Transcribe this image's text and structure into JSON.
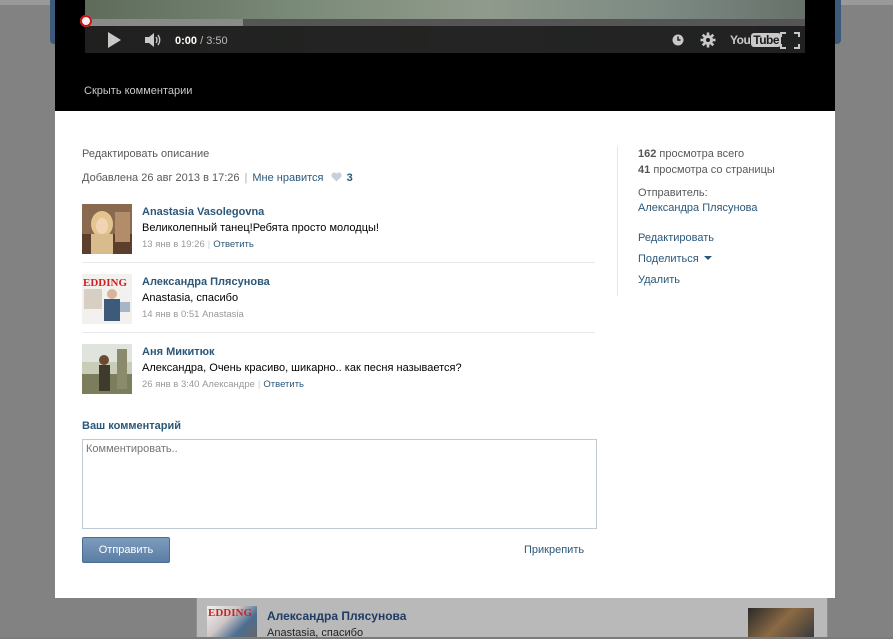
{
  "player": {
    "current_time": "0:00",
    "total_time": "3:50",
    "progress": 0.0,
    "buffered": 0.22,
    "brand": "You",
    "brand_tube": "Tube"
  },
  "hide_comments_label": "Скрыть комментарии",
  "description": {
    "edit_label": "Редактировать описание",
    "added_text": "Добавлена 26 авг 2013 в 17:26",
    "like_label": "Мне нравится",
    "like_count": "3"
  },
  "comments": [
    {
      "author": "Anastasia Vasolegovna",
      "text": "Великолепный танец!Ребята просто молодцы!",
      "date": "13 янв в 19:26",
      "reply": "Ответить",
      "extra": ""
    },
    {
      "author": "Александра Плясунова",
      "text": "Anastasia, спасибо",
      "date": "14 янв в 0:51 Anastasia",
      "reply": "",
      "extra": ""
    },
    {
      "author": "Аня Микитюк",
      "text": "Александра, Очень красиво, шикарно.. как песня называется?",
      "date": "26 янв в 3:40 Александре",
      "reply": "Ответить",
      "extra": ""
    }
  ],
  "comment_form": {
    "heading": "Ваш комментарий",
    "placeholder": "Комментировать..",
    "send_label": "Отправить",
    "attach_label": "Прикрепить"
  },
  "stats": {
    "total_views": "162",
    "total_views_label": "просмотра всего",
    "page_views": "41",
    "page_views_label": "просмотра со страницы"
  },
  "sender": {
    "label": "Отправитель:",
    "name": "Александра Плясунова"
  },
  "actions": {
    "edit": "Редактировать",
    "share": "Поделиться",
    "delete": "Удалить"
  },
  "background_feed": {
    "name": "Александра Плясунова",
    "text": "Anastasia, спасибо",
    "logo": "EDDING"
  },
  "colors": {
    "link": "#2b587a",
    "player_bg": "#000000",
    "overlay": "#828282"
  }
}
